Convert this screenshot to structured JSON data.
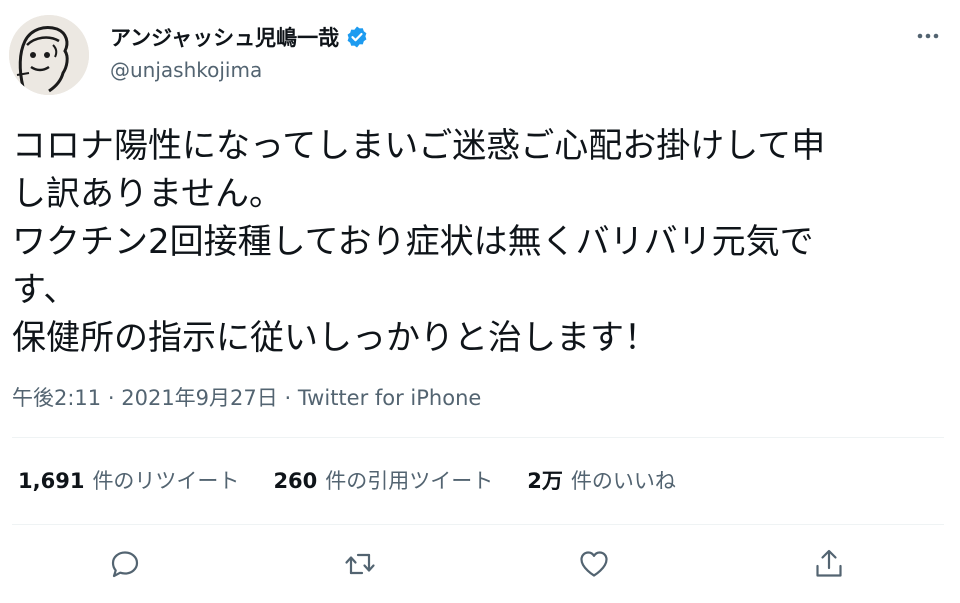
{
  "user": {
    "display_name": "アンジャッシュ児嶋一哉",
    "handle": "@unjashkojima",
    "avatar_icon": "cartoon-face-avatar",
    "verified_icon": "verified-badge-icon",
    "verified_color": "#1d9bf0"
  },
  "tweet": {
    "lines": [
      "コロナ陽性になってしまいご迷惑ご心配お掛けして申",
      "し訳ありません。",
      "ワクチン2回接種しており症状は無くバリバリ元気で",
      "す、",
      "保健所の指示に従いしっかりと治します！"
    ],
    "time": "午後2:11",
    "separator": "·",
    "date": "2021年9月27日",
    "source": "Twitter for iPhone"
  },
  "stats": {
    "retweets": {
      "count": "1,691",
      "label": "件のリツイート"
    },
    "quotes": {
      "count": "260",
      "label": "件の引用ツイート"
    },
    "likes": {
      "count": "2万",
      "label": "件のいいね"
    }
  },
  "actions": [
    "reply-icon",
    "retweet-icon",
    "like-icon",
    "share-icon"
  ],
  "colors": {
    "text": "#0f1419",
    "secondary": "#536471",
    "divider": "#eff3f4",
    "icon": "#536471"
  }
}
